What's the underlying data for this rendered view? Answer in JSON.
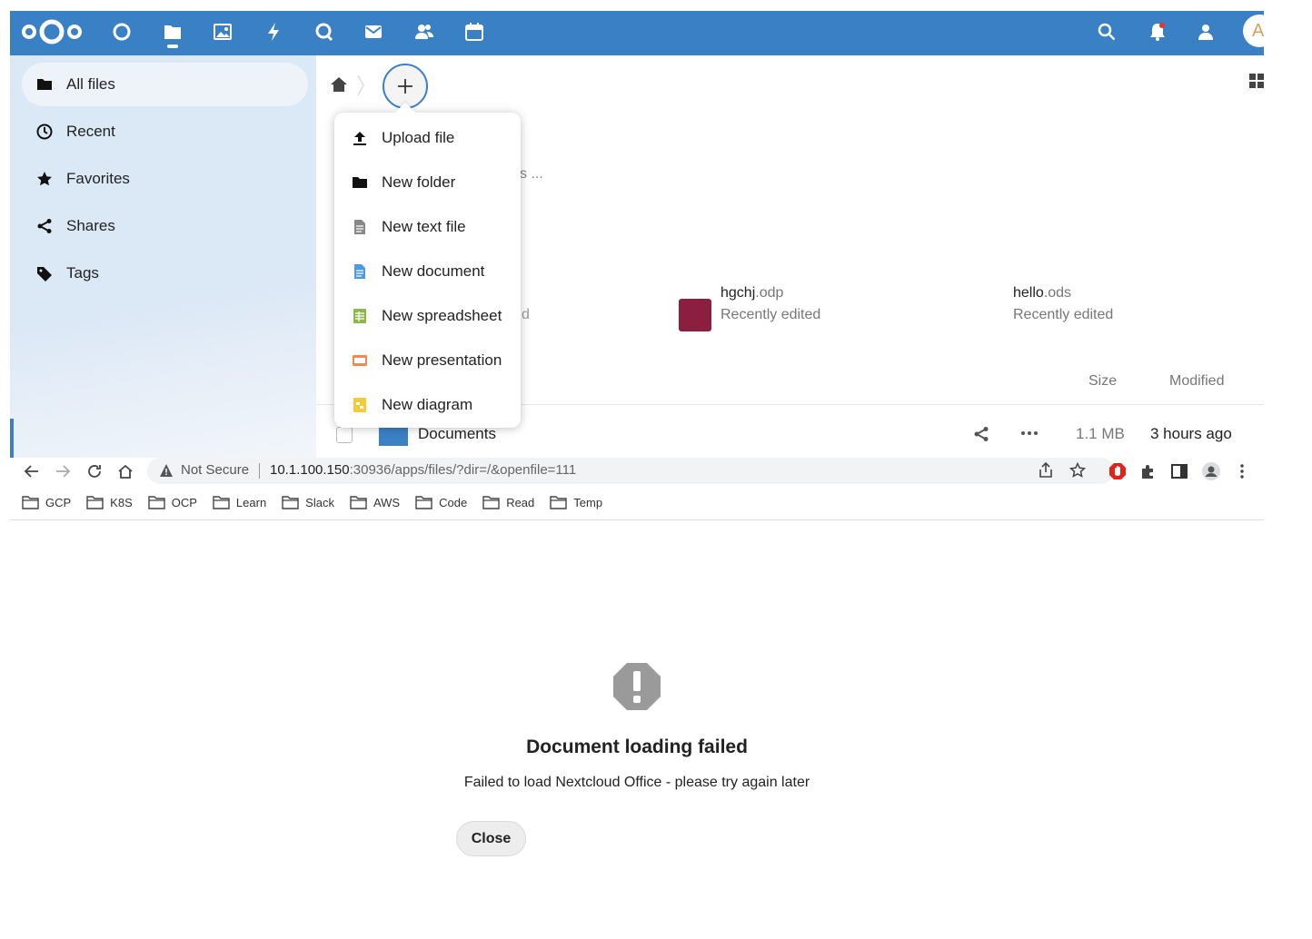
{
  "header": {
    "app_icons": [
      "dashboard-icon",
      "files-icon",
      "photos-icon",
      "activity-icon",
      "talk-icon",
      "mail-icon",
      "contacts-icon",
      "calendar-icon"
    ],
    "right_icons": [
      "search-icon",
      "notifications-icon",
      "contacts-menu-icon"
    ],
    "avatar_letter": "A",
    "brand_color": "#3a80c5"
  },
  "sidebar": {
    "items": [
      {
        "label": "All files",
        "icon": "folder-icon"
      },
      {
        "label": "Recent",
        "icon": "clock-icon"
      },
      {
        "label": "Favorites",
        "icon": "star-icon"
      },
      {
        "label": "Shares",
        "icon": "share-icon"
      },
      {
        "label": "Tags",
        "icon": "tag-icon"
      }
    ]
  },
  "main": {
    "partial_snippet": "s ...",
    "partial_snippet2": "d",
    "recent_cards": [
      {
        "name": "hgchj",
        "ext": ".odp",
        "sub": "Recently edited"
      },
      {
        "name": "hello",
        "ext": ".ods",
        "sub": "Recently edited"
      }
    ],
    "columns": {
      "size": "Size",
      "modified": "Modified"
    },
    "rows": [
      {
        "name": "Documents",
        "size": "1.1 MB",
        "modified": "3 hours ago"
      }
    ]
  },
  "new_menu": {
    "items": [
      {
        "label": "Upload file",
        "icon": "upload-icon"
      },
      {
        "label": "New folder",
        "icon": "folder-icon"
      },
      {
        "label": "New text file",
        "icon": "text-file-icon"
      },
      {
        "label": "New document",
        "icon": "document-icon"
      },
      {
        "label": "New spreadsheet",
        "icon": "spreadsheet-icon"
      },
      {
        "label": "New presentation",
        "icon": "presentation-icon"
      },
      {
        "label": "New diagram",
        "icon": "diagram-icon"
      }
    ]
  },
  "browser": {
    "security_label": "Not Secure",
    "url_host": "10.1.100.150",
    "url_path": ":30936/apps/files/?dir=/&openfile=111",
    "bookmarks": [
      "GCP",
      "K8S",
      "OCP",
      "Learn",
      "Slack",
      "AWS",
      "Code",
      "Read",
      "Temp"
    ]
  },
  "dialog": {
    "title": "Document loading failed",
    "message": "Failed to load Nextcloud Office - please try again later",
    "close_label": "Close"
  }
}
